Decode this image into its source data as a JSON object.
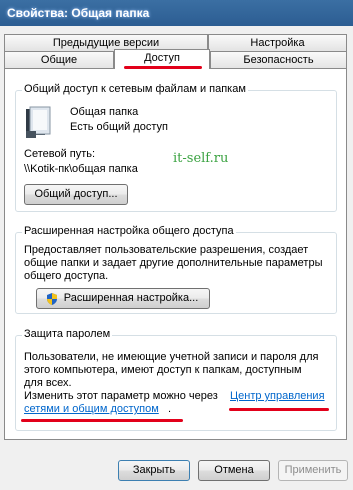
{
  "window": {
    "title": "Свойства: Общая папка"
  },
  "tabs": {
    "back_row": [
      "Предыдущие версии",
      "Настройка"
    ],
    "front_row": [
      "Общие",
      "Доступ",
      "Безопасность"
    ],
    "active": "Доступ"
  },
  "network_sharing": {
    "legend": "Общий доступ к сетевым файлам и папкам",
    "folder_name": "Общая папка",
    "status": "Есть общий доступ",
    "path_label": "Сетевой путь:",
    "path": "\\\\Kotik-пк\\общая папка",
    "share_button": "Общий доступ..."
  },
  "watermark": "it-self.ru",
  "advanced_sharing": {
    "legend": "Расширенная настройка общего доступа",
    "description": [
      "Предоставляет пользовательские разрешения, создает",
      "общие папки и задает другие дополнительные параметры",
      "общего доступа."
    ],
    "button": "Расширенная настройка..."
  },
  "password_protection": {
    "legend": "Защита паролем",
    "description": [
      "Пользователи, не имеющие учетной записи и пароля для",
      "этого компьютера, имеют доступ к папкам, доступным",
      "для всех."
    ],
    "change_text": "Изменить этот параметр можно через",
    "link_line1": "Центр управления",
    "link_line2": "сетями и общим доступом",
    "after_link": "."
  },
  "footer": {
    "close": "Закрыть",
    "cancel": "Отмена",
    "apply": "Применить"
  },
  "colors": {
    "accent_underline": "#e2001a",
    "link": "#0066cc",
    "watermark": "#3aa241"
  }
}
